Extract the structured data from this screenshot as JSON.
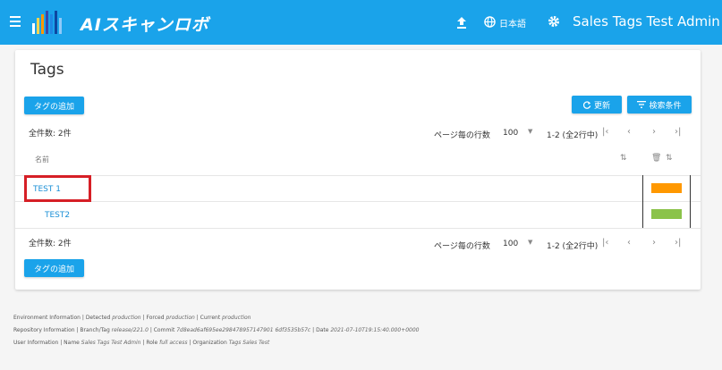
{
  "header": {
    "logo_text": "AIスキャンロボ",
    "language": "日本語",
    "user": "Sales Tags Test Admin"
  },
  "page": {
    "title": "Tags",
    "add_tag_label": "タグの追加",
    "refresh_label": "更新",
    "search_conditions_label": "検索条件",
    "total_label": "全件数: 2件",
    "rows_per_page_label": "ページ毎の行数",
    "rows_per_page_value": "100",
    "range_label": "1-2 (全2行中)",
    "column_name": "名前"
  },
  "tags": [
    {
      "name": "TEST 1",
      "color": "#ff9800"
    },
    {
      "name": "TEST2",
      "color": "#8bc34a"
    }
  ],
  "footer": {
    "env_label": "Environment Information |",
    "detected_label": "Detected",
    "detected_value": "production",
    "forced_label": "| Forced",
    "forced_value": "production",
    "current_label": "| Current",
    "current_value": "production",
    "repo_label": "Repository Information |",
    "branch_label": "Branch/Tag",
    "branch_value": "release/221.0",
    "commit_label": "| Commit",
    "commit_value": "7d8ead6af695ee298478957147901 6df3535b57c",
    "date_label": "| Date",
    "date_value": "2021-07-10T19:15:40.000+0000",
    "user_label": "User Information |",
    "name_label": "Name",
    "name_value": "Sales Tags Test Admin",
    "role_label": "| Role",
    "role_value": "full access",
    "org_label": "| Organization",
    "org_value": "Tags Sales Test"
  }
}
